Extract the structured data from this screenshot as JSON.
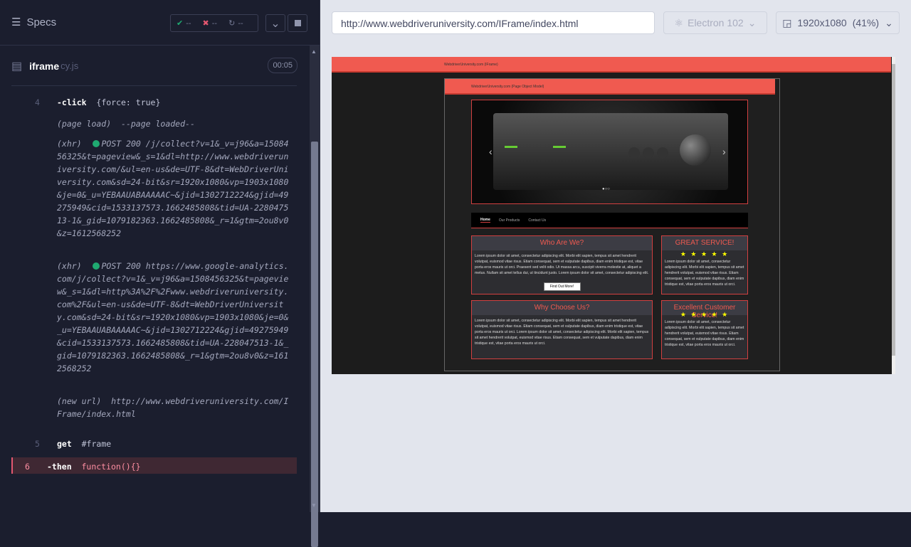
{
  "reporter": {
    "specs_label": "Specs",
    "passed": "--",
    "failed": "--",
    "pending": "--",
    "spec_name": "iframe",
    "spec_ext": "cy.js",
    "timer": "00:05"
  },
  "commands": [
    {
      "num": "4",
      "parts": [
        {
          "cls": "cmd",
          "t": "-click"
        },
        {
          "cls": "",
          "t": "  {force: true}"
        }
      ]
    },
    {
      "num": "",
      "parts": [
        {
          "cls": "dim",
          "t": "(page load)"
        },
        {
          "cls": "dim",
          "t": "  --page loaded--"
        }
      ]
    },
    {
      "num": "",
      "dot": true,
      "parts": [
        {
          "cls": "dim",
          "t": "(xhr)  "
        },
        {
          "cls": "dim",
          "t": "POST 200 /j/collect?v=1&_v=j96&a=1508456325&t=pageview&_s=1&dl=http://www.webdriveruniversity.com/&ul=en-us&de=UTF-8&dt=WebDriverUniversity.com&sd=24-bit&sr=1920x1080&vp=1903x1080&je=0&_u=YEBAAUABAAAAAC~&jid=1302712224&gjid=49275949&cid=1533137573.1662485808&tid=UA-228047513-1&_gid=1079182363.1662485808&_r=1&gtm=2ou8v0&z=1612568252"
        }
      ]
    },
    {
      "num": "",
      "dot": true,
      "parts": [
        {
          "cls": "dim",
          "t": "(xhr)  "
        },
        {
          "cls": "dim",
          "t": "POST 200 https://www.google-analytics.com/j/collect?v=1&_v=j96&a=1508456325&t=pageview&_s=1&dl=http%3A%2F%2Fwww.webdriveruniversity.com%2F&ul=en-us&de=UTF-8&dt=WebDriverUniversity.com&sd=24-bit&sr=1920x1080&vp=1903x1080&je=0&_u=YEBAAUABAAAAAC~&jid=1302712224&gjid=49275949&cid=1533137573.1662485808&tid=UA-228047513-1&_gid=1079182363.1662485808&_r=1&gtm=2ou8v0&z=1612568252"
        }
      ]
    },
    {
      "num": "",
      "parts": [
        {
          "cls": "dim",
          "t": "(new url)"
        },
        {
          "cls": "dim",
          "t": "  http://www.webdriveruniversity.com/IFrame/index.html"
        }
      ]
    },
    {
      "num": "5",
      "parts": [
        {
          "cls": "cmd",
          "t": "get"
        },
        {
          "cls": "",
          "t": "  #frame"
        }
      ]
    },
    {
      "num": "6",
      "active": true,
      "parts": [
        {
          "cls": "cmd",
          "t": "-then"
        },
        {
          "cls": "",
          "t": "  function(){}"
        }
      ]
    }
  ],
  "aut": {
    "url": "http://www.webdriveruniversity.com/IFrame/index.html",
    "browser": "Electron 102",
    "viewport": "1920x1080",
    "scale": "(41%)"
  },
  "site": {
    "top_title": "WebdriverUniversity.com (IFrame)",
    "inner_title": "WebdriverUniversity.com (Page Object Model)",
    "nav": [
      "Home",
      "Our Products",
      "Contact Us"
    ],
    "who_title": "Who Are We?",
    "who_text": "Lorem ipsum dolor sit amet, consectetur adipiscing elit. Morbi elit sapien, tempus sit amet hendrerit volutpat, euismod vitae risus. Etiam consequat, sem et vulputate dapibus, diam enim tristique est, vitae porta eros mauris ut orci. Praesent sed velit odio. Ut massa arcu, suscipit viverra molestie at, aliquet a metus. Nullam sit amet tellus dui, ut tincidunt justo. Lorem ipsum dolor sit amet, consectetur adipiscing elit.",
    "find_out": "Find Out More!",
    "great_title": "GREAT SERVICE!",
    "great_text": "Lorem ipsum dolor sit amet, consectetur adipiscing elit. Morbi elit sapien, tempus sit amet hendrerit volutpat, euismod vitae risus. Etiam consequat, sem et vulputate dapibus, diam enim tristique est, vitae porta eros mauris ut orci.",
    "why_title": "Why Choose Us?",
    "why_text": "Lorem ipsum dolor sit amet, consectetur adipiscing elit. Morbi elit sapien, tempus sit amet hendrerit volutpat, euismod vitae risus. Etiam consequat, sem et vulputate dapibus, diam enim tristique est, vitae porta eros mauris ut orci. Lorem ipsum dolor sit amet, consectetur adipiscing elit. Morbi elit sapien, tempus sit amet hendrerit volutpat, euismod vitae risus. Etiam consequat, sem et vulputate dapibus, diam enim tristique est, vitae porta eros mauris ut orci.",
    "excellent_title": "Excellent Customer Service!",
    "excellent_text": "Lorem ipsum dolor sit amet, consectetur adipiscing elit. Morbi elit sapien, tempus sit amet hendrerit volutpat, euismod vitae risus. Etiam consequat, sem et vulputate dapibus, diam enim tristique est, vitae porta eros mauris ut orci.",
    "stars": "★ ★ ★ ★ ★",
    "colors": {
      "accent": "#f05a50",
      "dark": "#1c1c1c",
      "pass": "#1fa971",
      "fail": "#e45770"
    }
  }
}
